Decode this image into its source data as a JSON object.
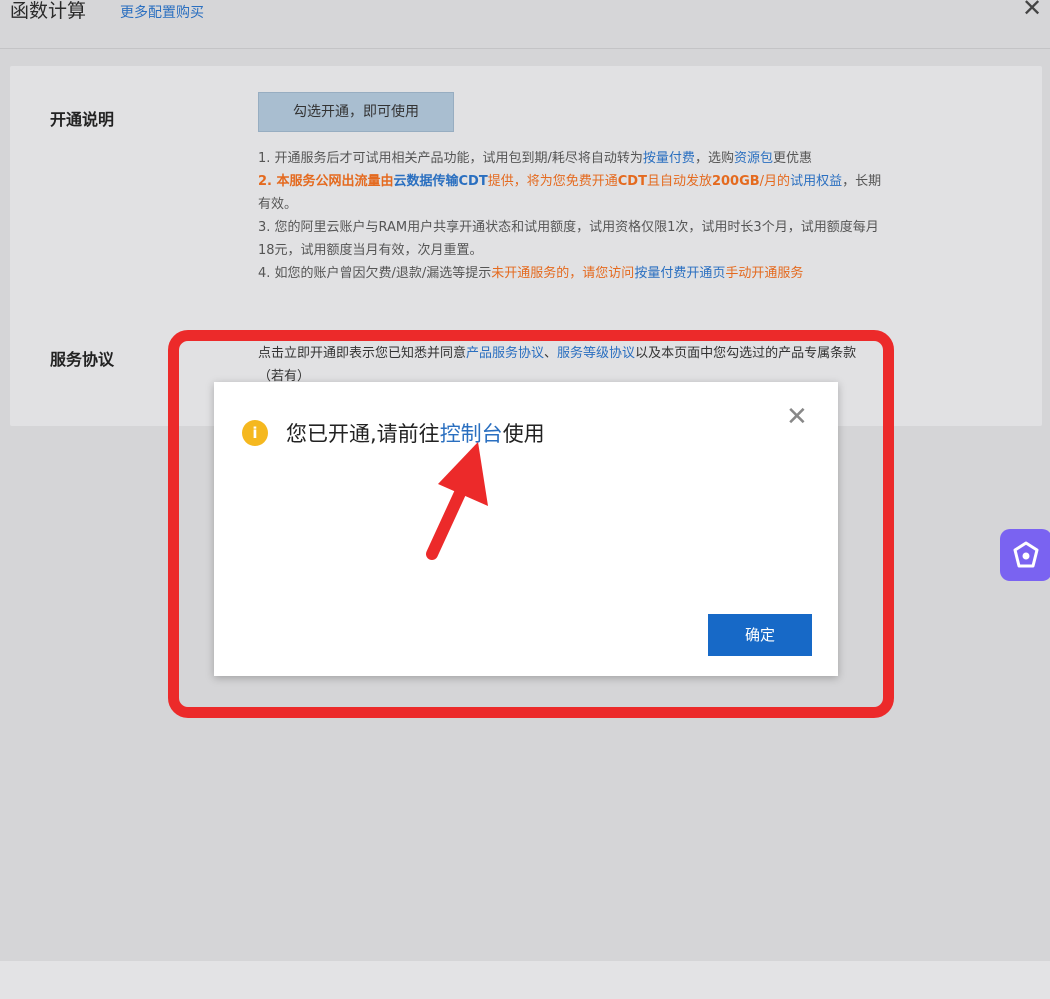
{
  "header": {
    "title": "函数计算",
    "more_link": "更多配置购买",
    "close_icon": "close-icon"
  },
  "activation": {
    "label": "开通说明",
    "check_button": "勾选开通，即可使用",
    "note1": {
      "prefix": "1. 开通服务后才可试用相关产品功能，试用包到期/耗尽将自动转为",
      "link1": "按量付费",
      "middle": "，选购",
      "link2": "资源包",
      "suffix": "更优惠"
    },
    "note2": {
      "part1": "2. 本服务公网出流量由",
      "link": "云数据传输CDT",
      "part2": "提供，将为您免费开通",
      "bold1": "CDT",
      "part3": "且自动发放",
      "bold2": "200GB",
      "part4": "/月的",
      "link2": "试用权益",
      "part5": "，长期",
      "line2": "有效。"
    },
    "note3": {
      "line1": "3. 您的阿里云账户与RAM用户共享开通状态和试用额度，试用资格仅限1次，试用时长3个月，试用额度每月",
      "line2": "18元，试用额度当月有效，次月重置。"
    },
    "note4": {
      "part1": "4. 如您的账户曾因欠费/退款/漏选等提示",
      "orange": "未开通服务的，请您访问",
      "link": "按量付费开通页",
      "suffix": "手动开通服务"
    }
  },
  "agreement": {
    "label": "服务协议",
    "prefix": "点击立即开通即表示您已知悉并同意",
    "link1": "产品服务协议",
    "sep": "、",
    "link2": "服务等级协议",
    "suffix": "以及本页面中您勾选过的产品专属条款",
    "line2": "（若有）"
  },
  "dialog": {
    "info_icon": "info-icon",
    "msg_prefix": "您已开通,请前往",
    "msg_link": "控制台",
    "msg_suffix": "使用",
    "close_icon": "close-icon",
    "ok_button": "确定"
  },
  "colors": {
    "link": "#2a6fc0",
    "accent_orange": "#e46a1f",
    "primary_button": "#1769c7",
    "annotation_red": "#ec2a2a",
    "assistant": "#7a63f1"
  }
}
